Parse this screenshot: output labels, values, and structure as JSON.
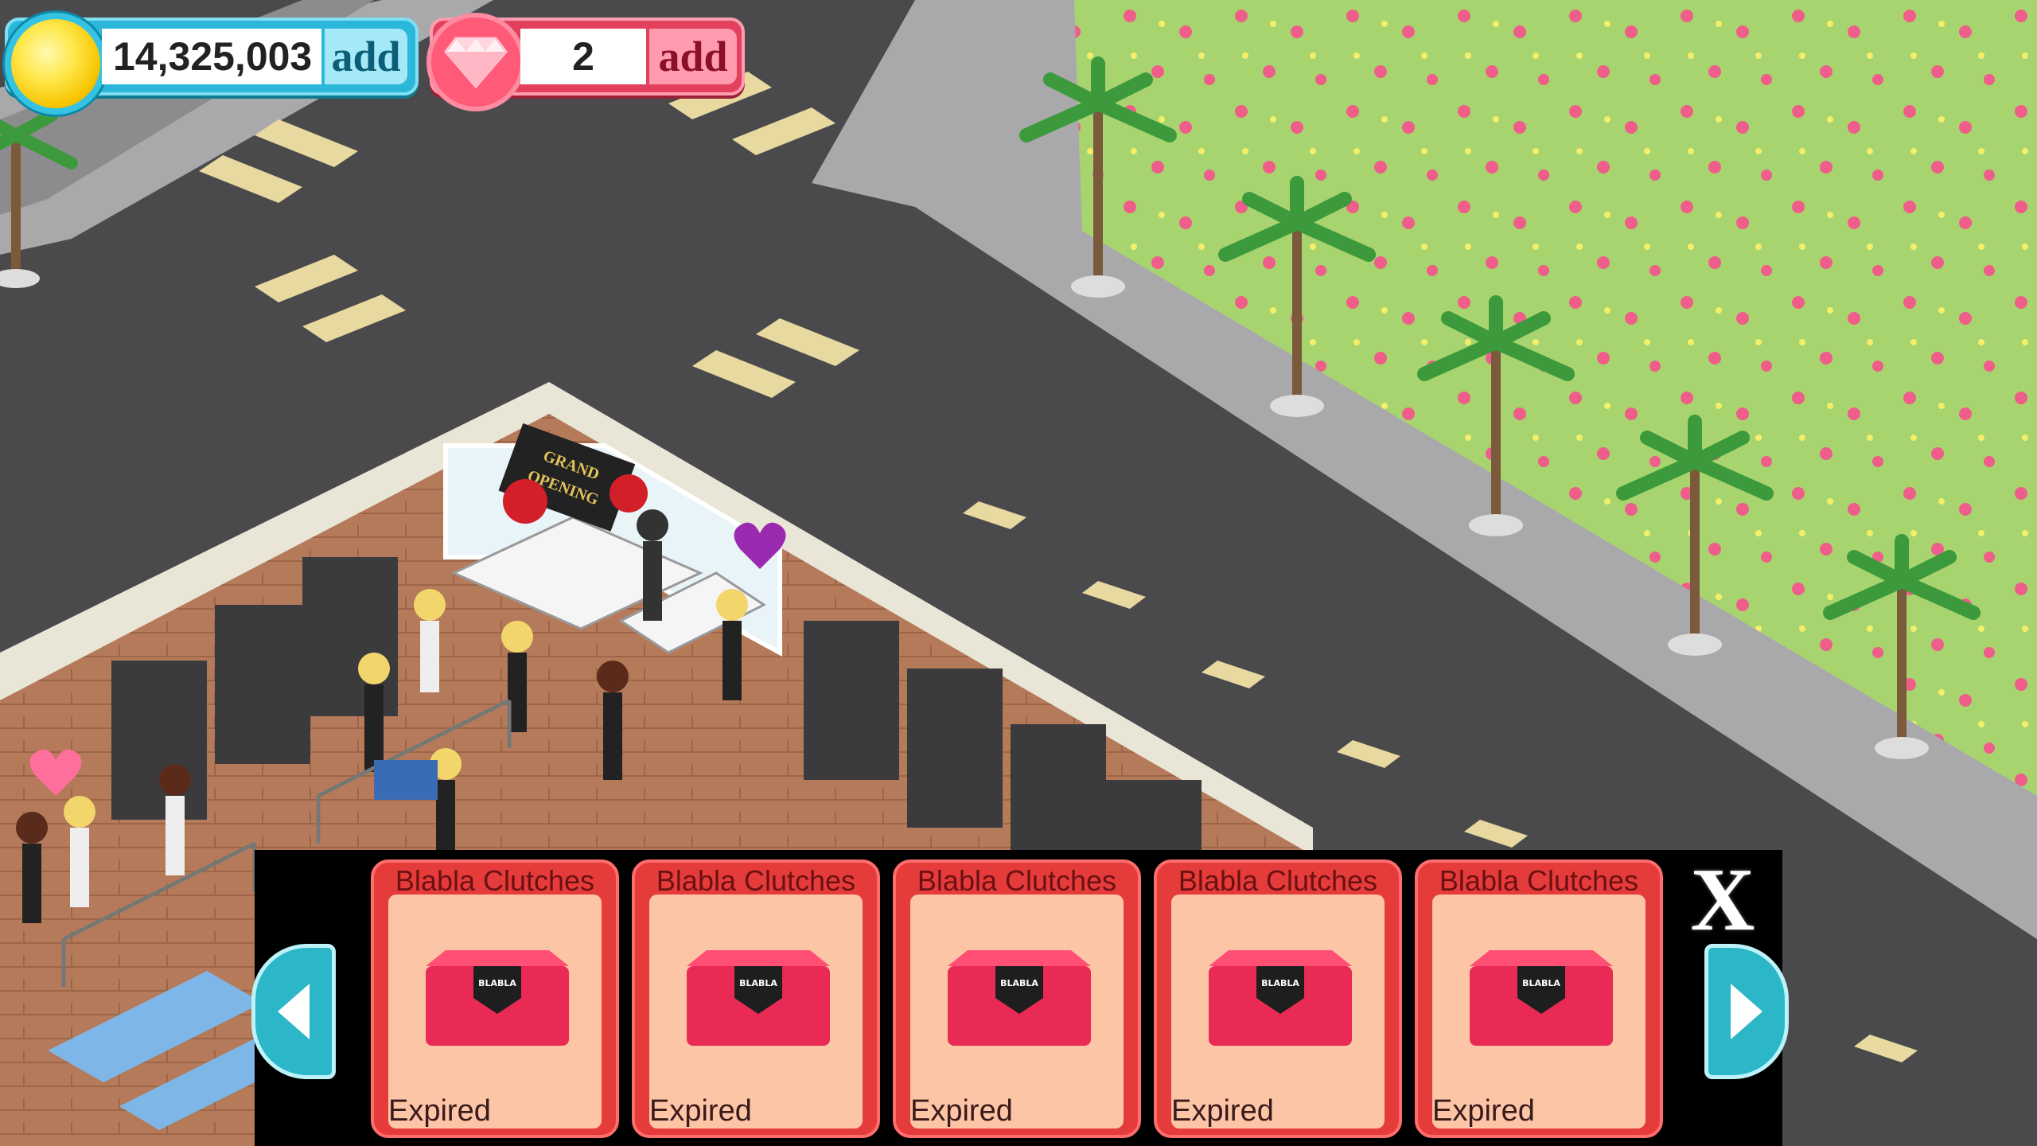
{
  "hud": {
    "coins": "14,325,003",
    "coin_add_label": "add",
    "gems": "2",
    "gem_add_label": "add"
  },
  "panel": {
    "close_label": "X",
    "items": [
      {
        "name": "Blabla Clutches",
        "status": "Expired",
        "brand": "BLABLA"
      },
      {
        "name": "Blabla Clutches",
        "status": "Expired",
        "brand": "BLABLA"
      },
      {
        "name": "Blabla Clutches",
        "status": "Expired",
        "brand": "BLABLA"
      },
      {
        "name": "Blabla Clutches",
        "status": "Expired",
        "brand": "BLABLA"
      },
      {
        "name": "Blabla Clutches",
        "status": "Expired",
        "brand": "BLABLA"
      }
    ]
  },
  "scene": {
    "sign_text": "GRAND OPENING"
  },
  "colors": {
    "road": "#4a4a4c",
    "sidewalk": "#a9a9ab",
    "grass": "#a8d46f",
    "card": "#e63b3b",
    "nav": "#2bb7c8"
  }
}
